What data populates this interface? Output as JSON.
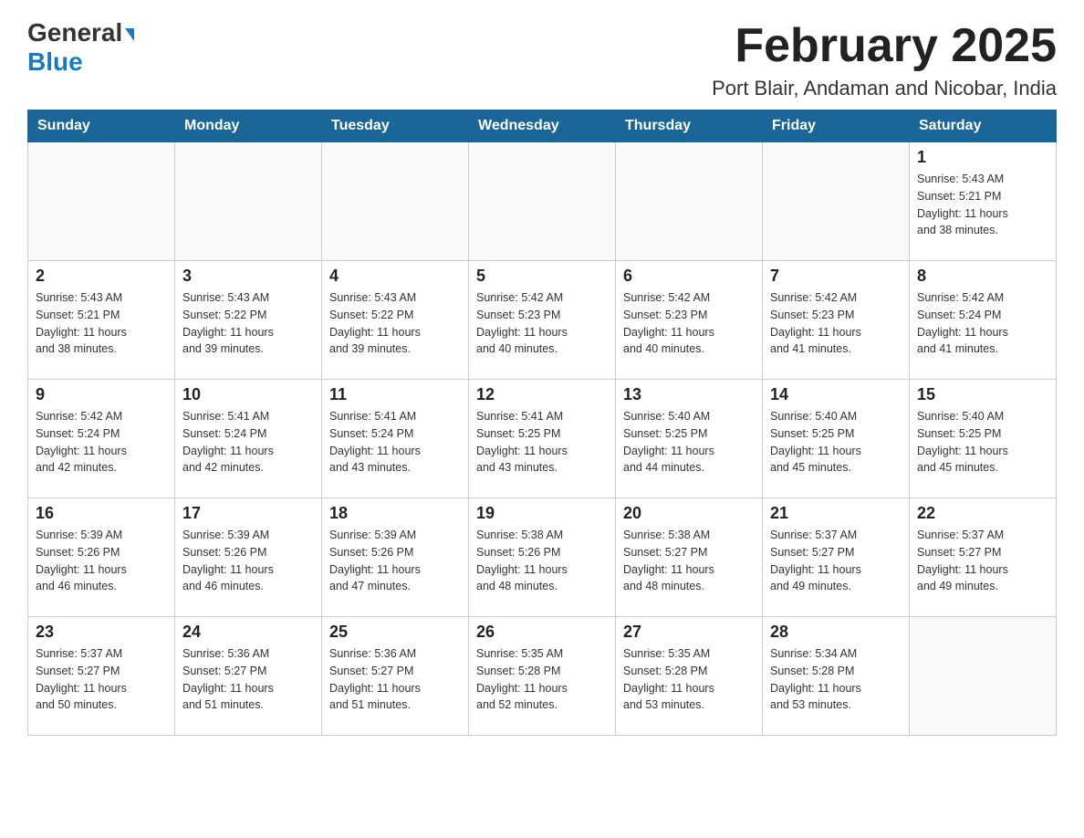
{
  "header": {
    "logo_general": "General",
    "logo_blue": "Blue",
    "main_title": "February 2025",
    "subtitle": "Port Blair, Andaman and Nicobar, India"
  },
  "days_of_week": [
    "Sunday",
    "Monday",
    "Tuesday",
    "Wednesday",
    "Thursday",
    "Friday",
    "Saturday"
  ],
  "weeks": [
    [
      {
        "day": "",
        "info": ""
      },
      {
        "day": "",
        "info": ""
      },
      {
        "day": "",
        "info": ""
      },
      {
        "day": "",
        "info": ""
      },
      {
        "day": "",
        "info": ""
      },
      {
        "day": "",
        "info": ""
      },
      {
        "day": "1",
        "info": "Sunrise: 5:43 AM\nSunset: 5:21 PM\nDaylight: 11 hours\nand 38 minutes."
      }
    ],
    [
      {
        "day": "2",
        "info": "Sunrise: 5:43 AM\nSunset: 5:21 PM\nDaylight: 11 hours\nand 38 minutes."
      },
      {
        "day": "3",
        "info": "Sunrise: 5:43 AM\nSunset: 5:22 PM\nDaylight: 11 hours\nand 39 minutes."
      },
      {
        "day": "4",
        "info": "Sunrise: 5:43 AM\nSunset: 5:22 PM\nDaylight: 11 hours\nand 39 minutes."
      },
      {
        "day": "5",
        "info": "Sunrise: 5:42 AM\nSunset: 5:23 PM\nDaylight: 11 hours\nand 40 minutes."
      },
      {
        "day": "6",
        "info": "Sunrise: 5:42 AM\nSunset: 5:23 PM\nDaylight: 11 hours\nand 40 minutes."
      },
      {
        "day": "7",
        "info": "Sunrise: 5:42 AM\nSunset: 5:23 PM\nDaylight: 11 hours\nand 41 minutes."
      },
      {
        "day": "8",
        "info": "Sunrise: 5:42 AM\nSunset: 5:24 PM\nDaylight: 11 hours\nand 41 minutes."
      }
    ],
    [
      {
        "day": "9",
        "info": "Sunrise: 5:42 AM\nSunset: 5:24 PM\nDaylight: 11 hours\nand 42 minutes."
      },
      {
        "day": "10",
        "info": "Sunrise: 5:41 AM\nSunset: 5:24 PM\nDaylight: 11 hours\nand 42 minutes."
      },
      {
        "day": "11",
        "info": "Sunrise: 5:41 AM\nSunset: 5:24 PM\nDaylight: 11 hours\nand 43 minutes."
      },
      {
        "day": "12",
        "info": "Sunrise: 5:41 AM\nSunset: 5:25 PM\nDaylight: 11 hours\nand 43 minutes."
      },
      {
        "day": "13",
        "info": "Sunrise: 5:40 AM\nSunset: 5:25 PM\nDaylight: 11 hours\nand 44 minutes."
      },
      {
        "day": "14",
        "info": "Sunrise: 5:40 AM\nSunset: 5:25 PM\nDaylight: 11 hours\nand 45 minutes."
      },
      {
        "day": "15",
        "info": "Sunrise: 5:40 AM\nSunset: 5:25 PM\nDaylight: 11 hours\nand 45 minutes."
      }
    ],
    [
      {
        "day": "16",
        "info": "Sunrise: 5:39 AM\nSunset: 5:26 PM\nDaylight: 11 hours\nand 46 minutes."
      },
      {
        "day": "17",
        "info": "Sunrise: 5:39 AM\nSunset: 5:26 PM\nDaylight: 11 hours\nand 46 minutes."
      },
      {
        "day": "18",
        "info": "Sunrise: 5:39 AM\nSunset: 5:26 PM\nDaylight: 11 hours\nand 47 minutes."
      },
      {
        "day": "19",
        "info": "Sunrise: 5:38 AM\nSunset: 5:26 PM\nDaylight: 11 hours\nand 48 minutes."
      },
      {
        "day": "20",
        "info": "Sunrise: 5:38 AM\nSunset: 5:27 PM\nDaylight: 11 hours\nand 48 minutes."
      },
      {
        "day": "21",
        "info": "Sunrise: 5:37 AM\nSunset: 5:27 PM\nDaylight: 11 hours\nand 49 minutes."
      },
      {
        "day": "22",
        "info": "Sunrise: 5:37 AM\nSunset: 5:27 PM\nDaylight: 11 hours\nand 49 minutes."
      }
    ],
    [
      {
        "day": "23",
        "info": "Sunrise: 5:37 AM\nSunset: 5:27 PM\nDaylight: 11 hours\nand 50 minutes."
      },
      {
        "day": "24",
        "info": "Sunrise: 5:36 AM\nSunset: 5:27 PM\nDaylight: 11 hours\nand 51 minutes."
      },
      {
        "day": "25",
        "info": "Sunrise: 5:36 AM\nSunset: 5:27 PM\nDaylight: 11 hours\nand 51 minutes."
      },
      {
        "day": "26",
        "info": "Sunrise: 5:35 AM\nSunset: 5:28 PM\nDaylight: 11 hours\nand 52 minutes."
      },
      {
        "day": "27",
        "info": "Sunrise: 5:35 AM\nSunset: 5:28 PM\nDaylight: 11 hours\nand 53 minutes."
      },
      {
        "day": "28",
        "info": "Sunrise: 5:34 AM\nSunset: 5:28 PM\nDaylight: 11 hours\nand 53 minutes."
      },
      {
        "day": "",
        "info": ""
      }
    ]
  ]
}
